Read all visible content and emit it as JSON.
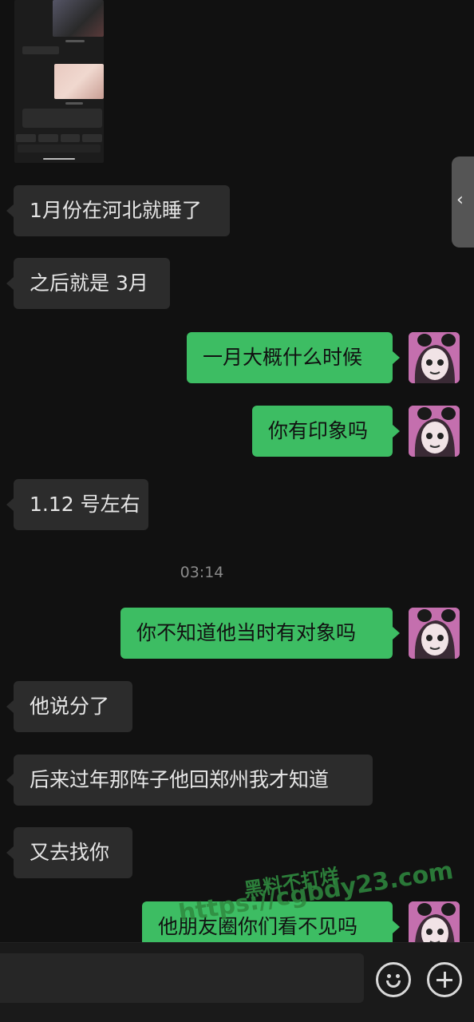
{
  "timestamp": "03:14",
  "watermark": {
    "line1": "黑料不打烊",
    "line2": "https://cgbdy23.com"
  },
  "messages": [
    {
      "side": "left",
      "text": "1月份在河北就睡了"
    },
    {
      "side": "left",
      "text": "之后就是 3月"
    },
    {
      "side": "right",
      "text": "一月大概什么时候"
    },
    {
      "side": "right",
      "text": "你有印象吗"
    },
    {
      "side": "left",
      "text": "1.12 号左右"
    },
    {
      "side": "right",
      "text": "你不知道他当时有对象吗"
    },
    {
      "side": "left",
      "text": "他说分了"
    },
    {
      "side": "left",
      "text": "后来过年那阵子他回郑州我才知道"
    },
    {
      "side": "left",
      "text": "又去找你"
    },
    {
      "side": "right",
      "text": "他朋友圈你们看不见吗"
    }
  ],
  "side_tab": {
    "icon": "chevron-left-icon",
    "glyph": "‹"
  },
  "input_bar": {
    "emoji_icon": "emoji-icon",
    "plus_icon": "plus-circle-icon"
  },
  "colors": {
    "left_bubble": "#2c2c2c",
    "right_bubble": "#3dbd63",
    "background": "#111111"
  }
}
